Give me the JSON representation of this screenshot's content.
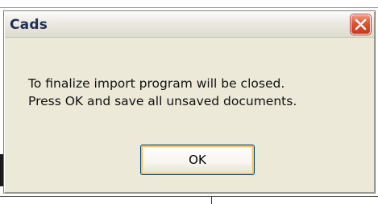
{
  "dialog": {
    "title": "Cads",
    "message_lines": [
      "To finalize import program will be closed.",
      "Press OK and save all unsaved documents."
    ],
    "ok_label": "OK",
    "close_icon": "close-icon"
  },
  "colors": {
    "dialog_bg": "#ece9d8",
    "title_text": "#1f2f55",
    "close_button": "#e0522f",
    "button_focus": "#f6c66a"
  }
}
